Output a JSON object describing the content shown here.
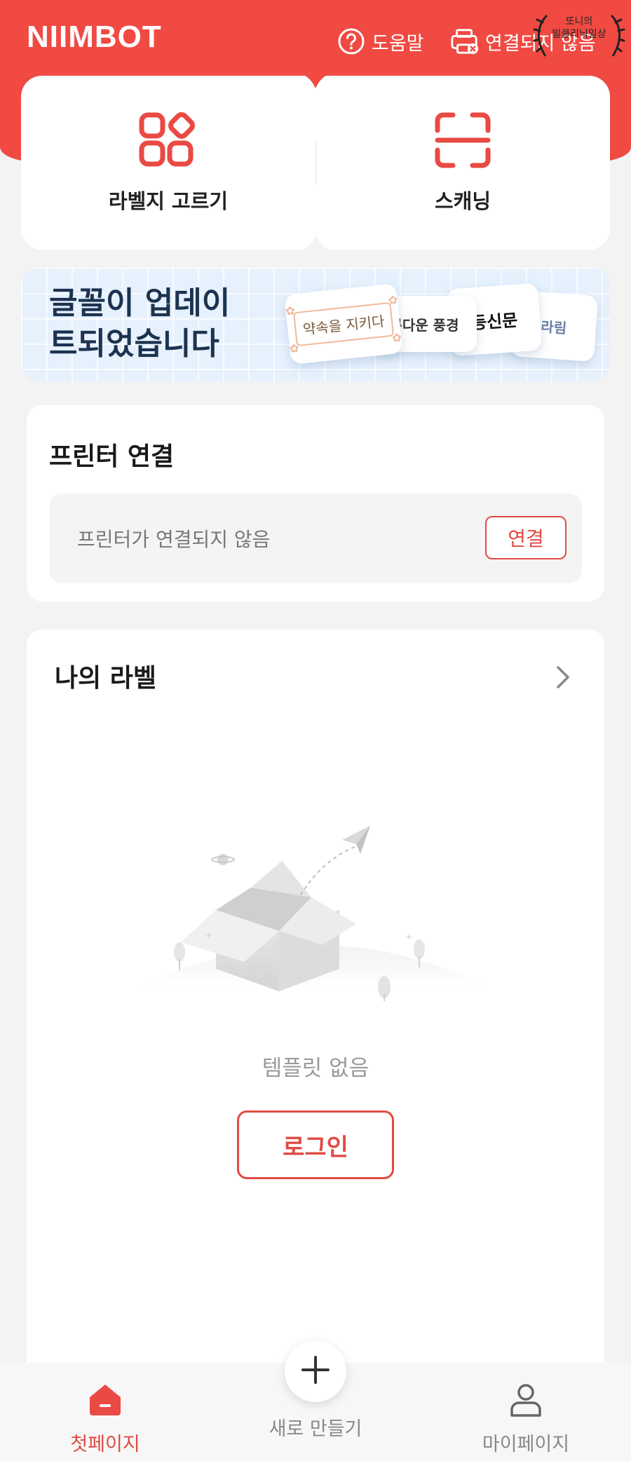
{
  "header": {
    "brand": "NIIMBOT",
    "help_label": "도움말",
    "printer_status_label": "연결되지 않음",
    "watermark_line1": "또니의",
    "watermark_line2": "빌클리닉일상"
  },
  "actions": {
    "choose_label": "라벨지 고르기",
    "scan_label": "스캐닝"
  },
  "banner": {
    "title_line1": "글꼴이 업데이",
    "title_line2": "트되었습니다",
    "ticket1": "약속을 지키다",
    "ticket2": "름다운 풍경",
    "ticket3": "등신문",
    "ticket4": "라림"
  },
  "printer": {
    "title": "프린터 연결",
    "status": "프린터가 연결되지 않음",
    "connect_label": "연결"
  },
  "my_labels": {
    "title": "나의 라벨",
    "empty_text": "템플릿 없음",
    "login_label": "로그인"
  },
  "nav": {
    "home_label": "첫페이지",
    "new_label": "새로 만들기",
    "my_label": "마이페이지"
  },
  "colors": {
    "brand_red": "#f04a43",
    "accent_red": "#e14a43",
    "banner_bg": "#e6f1fd"
  }
}
